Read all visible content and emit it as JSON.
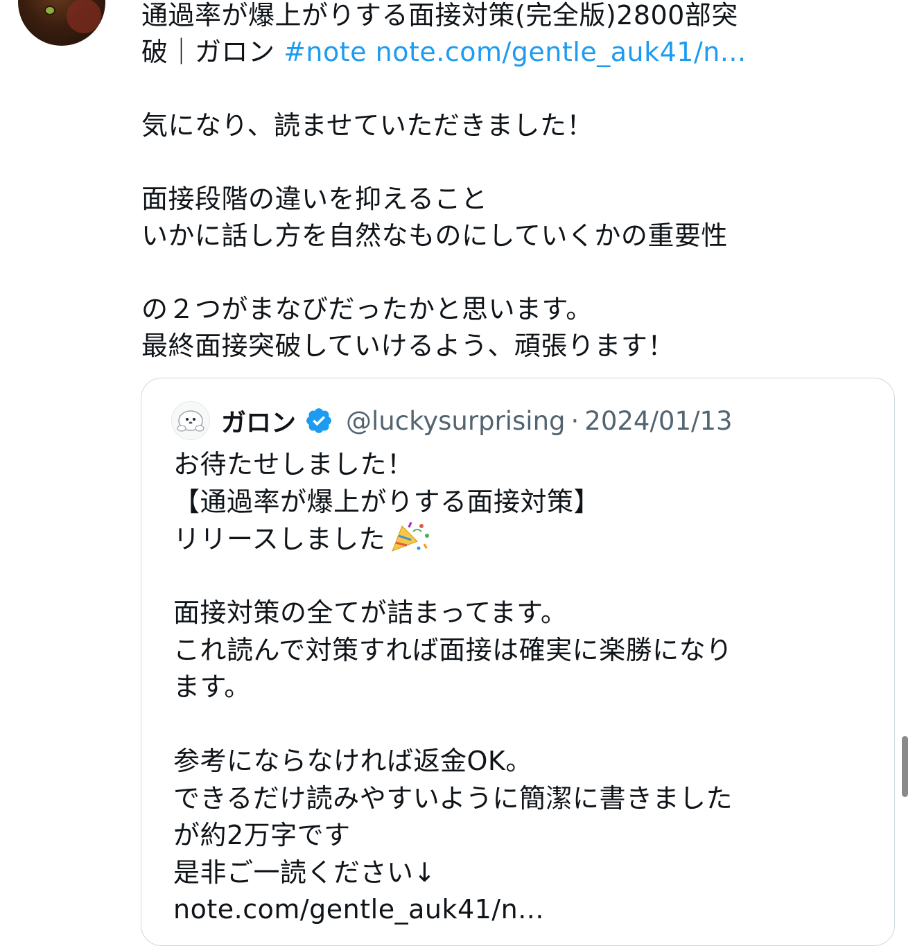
{
  "tweet": {
    "lines": [
      "通過率が爆上がりする面接対策(完全版)2800部突",
      "破｜ガロン "
    ],
    "hashtag": "#note",
    "link": "note.com/gentle_auk41/n...",
    "paragraph1": "気になり、読ませていただきました！",
    "paragraph2_line1": "面接段階の違いを抑えること",
    "paragraph2_line2": "いかに話し方を自然なものにしていくかの重要性",
    "paragraph3_line1": "の２つがまなびだったかと思います。",
    "paragraph3_line2": "最終面接突破していけるよう、頑張ります！"
  },
  "quote": {
    "name": "ガロン",
    "handle": "@luckysurprising",
    "separator": "·",
    "date": "2024/01/13",
    "lines": [
      "お待たせしました！",
      "【通過率が爆上がりする面接対策】",
      "リリースしました"
    ],
    "block2": [
      "面接対策の全てが詰まってます。",
      "これ読んで対策すれば面接は確実に楽勝になり",
      "ます。"
    ],
    "block3": [
      "参考にならなければ返金OK。",
      "できるだけ読みやすいように簡潔に書きました",
      "が約2万字です",
      "是非ご一読ください↓",
      "note.com/gentle_auk41/n..."
    ]
  },
  "icons": {
    "verified": "verified-badge-icon",
    "party": "party-popper-icon"
  },
  "colors": {
    "link": "#1d9bf0",
    "text": "#0f1419",
    "secondary": "#536471",
    "border": "#cfd9de"
  }
}
